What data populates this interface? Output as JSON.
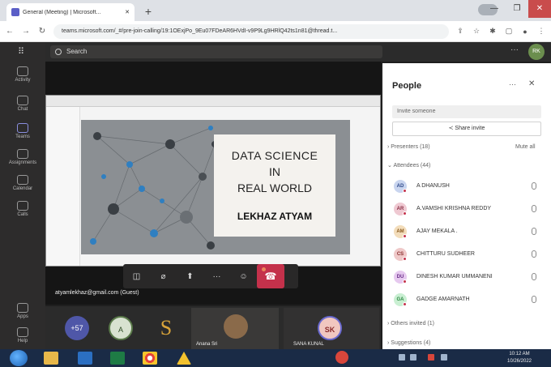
{
  "browser": {
    "tab_title": "General (Meeting) | Microsoft...",
    "new_tab": "+",
    "url": "teams.microsoft.com/_#/pre-join-calling/19:1OExjPo_9Eu07FDeAR6HVdI-v9P9Lg9HRlQ42ts1n81@thread.t..."
  },
  "teams": {
    "search_placeholder": "Search",
    "me_initials": "RK",
    "rail": [
      "Activity",
      "Chat",
      "Teams",
      "Assignments",
      "Calendar",
      "Calls",
      "Apps",
      "Help"
    ]
  },
  "slide": {
    "line1": "DATA SCIENCE",
    "line2": "IN",
    "line3": "REAL WORLD",
    "author": "LEKHAZ ATYAM"
  },
  "presenter_label": "atyamlekhaz@gmail.com (Guest)",
  "strip": {
    "more_count": "+57",
    "a_initial": "A",
    "s_letter": "S",
    "anana_name": "Anana Sri",
    "sana_initials": "SK",
    "sana_name": "SANA KUNAL"
  },
  "people": {
    "title": "People",
    "invite_placeholder": "Invite someone",
    "share_invite": "Share invite",
    "presenters": "Presenters (18)",
    "mute_all": "Mute all",
    "attendees": "Attendees (44)",
    "attendee_list": [
      {
        "initials": "AD",
        "name": "A DHANUSH",
        "bg": "#c9d5ef",
        "fg": "#2f4a8a"
      },
      {
        "initials": "AR",
        "name": "A.VAMSHI KRISHNA REDDY",
        "bg": "#efc9d2",
        "fg": "#8a2f45"
      },
      {
        "initials": "AM",
        "name": "AJAY MEKALA .",
        "bg": "#f3ddbb",
        "fg": "#8a5a1f"
      },
      {
        "initials": "CS",
        "name": "CHITTURU SUDHEER",
        "bg": "#efc9c9",
        "fg": "#8a2f2f"
      },
      {
        "initials": "DU",
        "name": "DINESH KUMAR UMMANENI",
        "bg": "#e6c9ef",
        "fg": "#6a2f8a"
      },
      {
        "initials": "GA",
        "name": "GADGE AMARNATH",
        "bg": "#c9efd2",
        "fg": "#2f8a45"
      }
    ],
    "others_invited": "Others invited (1)",
    "suggestions": "Suggestions (4)"
  },
  "taskbar": {
    "time": "10:12 AM",
    "date": "10/26/2022"
  },
  "colors": {
    "hangup": "#c4314b",
    "teams_purple": "#5b5fc7",
    "taskbar": "#1a2b46"
  }
}
